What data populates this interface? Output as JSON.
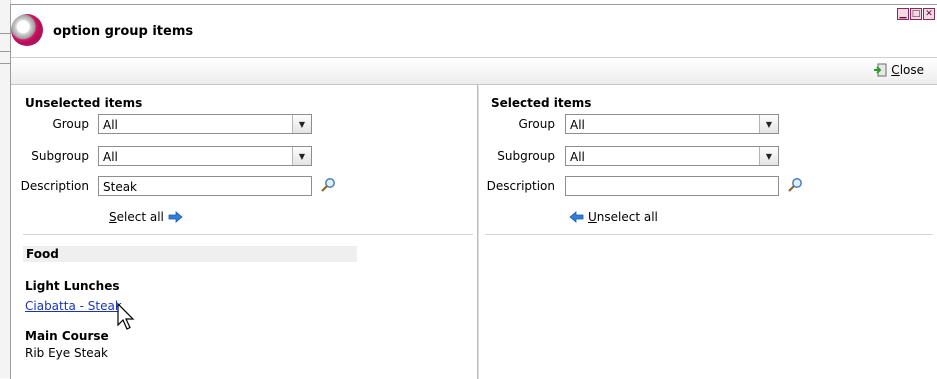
{
  "window": {
    "title": "option group items",
    "controls": [
      "minimize-icon",
      "maximize-icon",
      "close-icon"
    ]
  },
  "toolbar": {
    "close_label": "Close",
    "close_icon": "exit-door-icon"
  },
  "left_panel": {
    "title": "Unselected items",
    "group_label": "Group",
    "group_value": "All",
    "subgroup_label": "Subgroup",
    "subgroup_value": "All",
    "description_label": "Description",
    "description_value": "Steak",
    "select_all_label": "Select all"
  },
  "right_panel": {
    "title": "Selected items",
    "group_label": "Group",
    "group_value": "All",
    "subgroup_label": "Subgroup",
    "subgroup_value": "All",
    "description_label": "Description",
    "description_value": "",
    "unselect_all_label": "Unselect all"
  },
  "results": {
    "category": "Food",
    "groups": [
      {
        "title": "Light Lunches",
        "items": [
          {
            "label": "Ciabatta - Steak",
            "link": true
          }
        ]
      },
      {
        "title": "Main Course",
        "items": [
          {
            "label": "Rib Eye Steak",
            "link": false
          }
        ]
      }
    ]
  },
  "colors": {
    "link": "#1a35b8",
    "accent": "#d6166b",
    "arrow": "#2f7fd6"
  }
}
